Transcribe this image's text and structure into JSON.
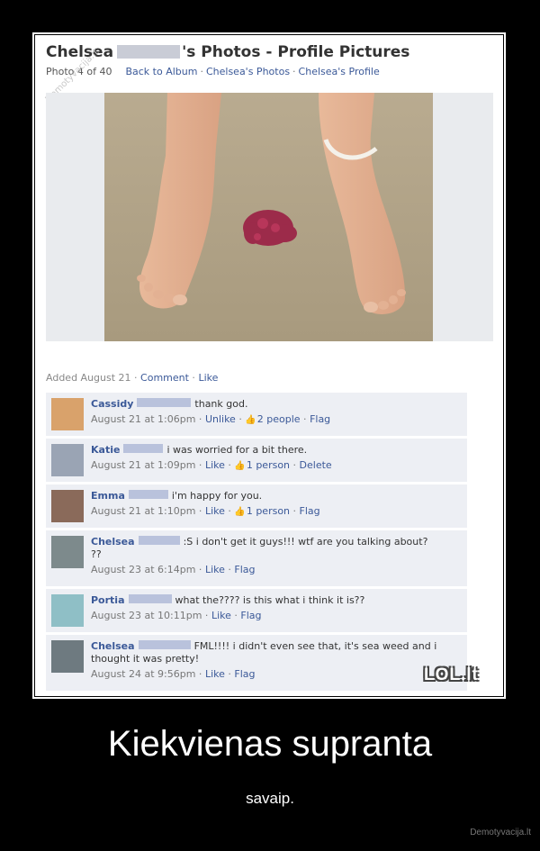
{
  "header": {
    "name_first": "Chelsea",
    "title_suffix": "'s Photos",
    "title_dash": " - ",
    "album": "Profile Pictures",
    "photo_counter": "Photo 4 of 40",
    "links": [
      "Back to Album",
      "Chelsea's Photos",
      "Chelsea's Profile"
    ]
  },
  "watermark_corner": "Demotyvacija.lt",
  "photo_alt": "feet on sand with red seaweed",
  "added": {
    "text": "Added August 21",
    "links": [
      "Comment",
      "Like"
    ]
  },
  "comments": [
    {
      "name": "Cassidy",
      "text": "thank god.",
      "date": "August 21 at 1:06pm",
      "actions": [
        "Unlike"
      ],
      "likes": "2 people",
      "extra": "Flag",
      "avatar_color": "#d9a26b",
      "blur_w": 60
    },
    {
      "name": "Katie",
      "text": "i was worried for a bit there.",
      "date": "August 21 at 1:09pm",
      "actions": [
        "Like"
      ],
      "likes": "1 person",
      "extra": "Delete",
      "avatar_color": "#9aa4b4",
      "blur_w": 44
    },
    {
      "name": "Emma",
      "text": "i'm happy for you.",
      "date": "August 21 at 1:10pm",
      "actions": [
        "Like"
      ],
      "likes": "1 person",
      "extra": "Flag",
      "avatar_color": "#8a6a5a",
      "blur_w": 44
    },
    {
      "name": "Chelsea",
      "text": ":S i don't get it guys!!! wtf are you talking about?",
      "text2": "??",
      "date": "August 23 at 6:14pm",
      "actions": [
        "Like"
      ],
      "likes": "",
      "extra": "Flag",
      "avatar_color": "#7d8a8c",
      "blur_w": 46
    },
    {
      "name": "Portia",
      "text": "what the???? is this what i think it is??",
      "date": "August 23 at 10:11pm",
      "actions": [
        "Like"
      ],
      "likes": "",
      "extra": "Flag",
      "avatar_color": "#8fbfc6",
      "blur_w": 48
    },
    {
      "name": "Chelsea",
      "text": "FML!!!! i didn't even see that, it's sea weed and i",
      "text2": "thought it was pretty!",
      "date": "August 24 at 9:56pm",
      "actions": [
        "Like"
      ],
      "likes": "",
      "extra": "Flag",
      "avatar_color": "#6e7a80",
      "blur_w": 58
    }
  ],
  "lol_logo": "LOL.lt",
  "caption": "Kiekvienas supranta",
  "subcaption": "savaip.",
  "credit": "Demotyvacija.lt"
}
